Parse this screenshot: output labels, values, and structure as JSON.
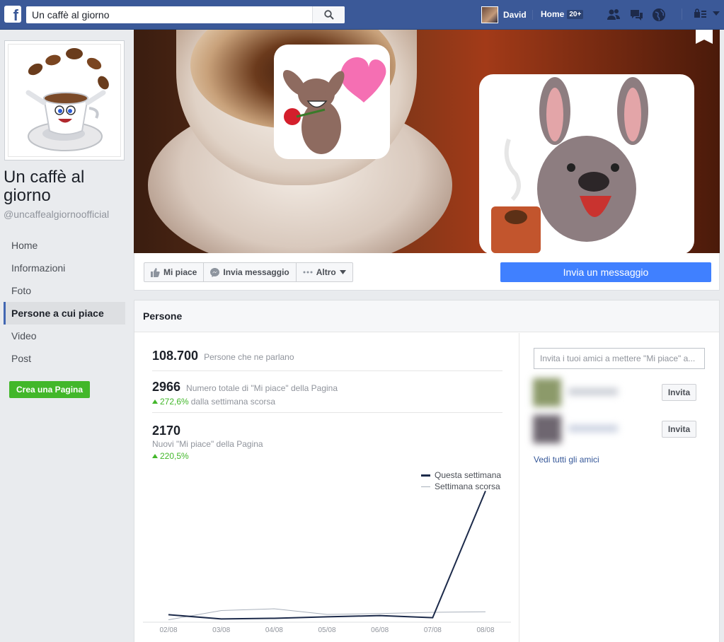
{
  "topbar": {
    "search_value": "Un caffè al giorno",
    "user_name": "David",
    "home_label": "Home",
    "home_badge": "20+"
  },
  "page": {
    "name": "Un caffè al giorno",
    "handle": "@uncaffealgiornoofficial"
  },
  "left_nav": {
    "items": [
      {
        "label": "Home"
      },
      {
        "label": "Informazioni"
      },
      {
        "label": "Foto"
      },
      {
        "label": "Persone a cui piace",
        "active": true
      },
      {
        "label": "Video"
      },
      {
        "label": "Post"
      }
    ],
    "create_page": "Crea una Pagina"
  },
  "actions": {
    "like": "Mi piace",
    "message": "Invia messaggio",
    "more": "Altro",
    "send_message": "Invia un messaggio"
  },
  "people": {
    "header": "Persone",
    "talking_count": "108.700",
    "talking_label": "Persone che ne parlano",
    "likes_total": "2966",
    "likes_total_label": "Numero totale di \"Mi piace\" della Pagina",
    "likes_growth": "272,6%",
    "likes_growth_suffix": "dalla settimana scorsa",
    "new_likes": "2170",
    "new_likes_label": "Nuovi \"Mi piace\" della Pagina",
    "new_likes_growth": "220,5%"
  },
  "chart_data": {
    "type": "line",
    "categories": [
      "02/08",
      "03/08",
      "04/08",
      "05/08",
      "06/08",
      "07/08",
      "08/08"
    ],
    "series": [
      {
        "name": "Questa settimana",
        "color": "#1c2a4a",
        "values": [
          90,
          20,
          30,
          55,
          75,
          40,
          2170
        ]
      },
      {
        "name": "Settimana scorsa",
        "color": "#a8b0bb",
        "values": [
          5,
          160,
          190,
          95,
          110,
          130,
          140
        ]
      }
    ],
    "ylim": [
      0,
      2400
    ],
    "legend": "top-right",
    "grid": false
  },
  "invite": {
    "placeholder": "Invita i tuoi amici a mettere \"Mi piace\" a...",
    "invite_label": "Invita",
    "see_all": "Vedi tutti gli amici"
  },
  "colors": {
    "brand": "#3b5998",
    "accent": "#4080ff",
    "green": "#42b72a"
  }
}
